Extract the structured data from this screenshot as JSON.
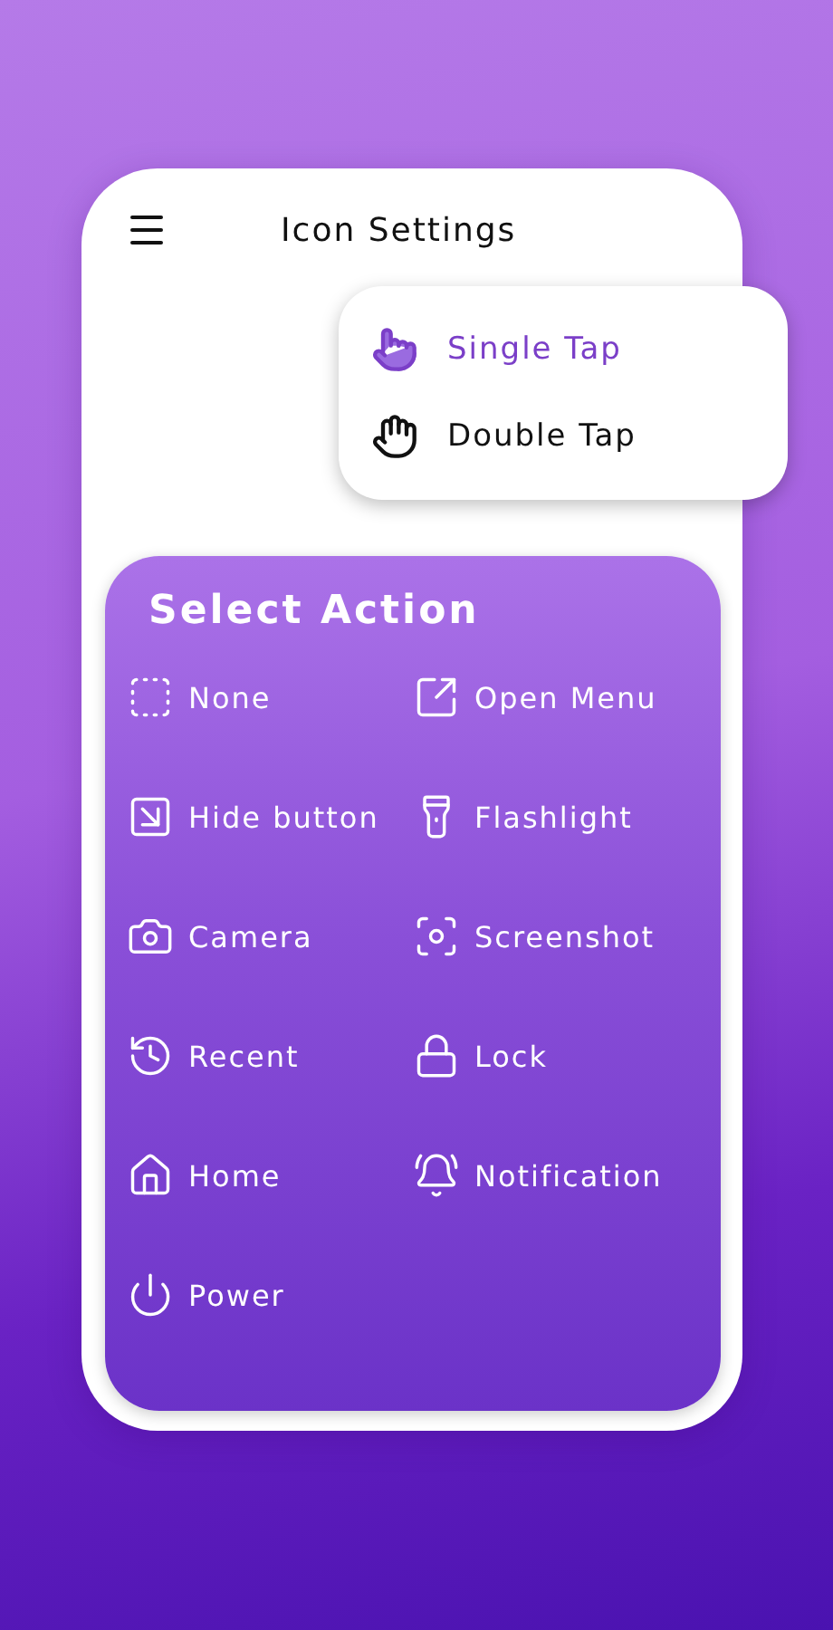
{
  "header": {
    "title": "Icon Settings"
  },
  "tap_menu": [
    {
      "label": "Single Tap",
      "kind": "single",
      "selected": true
    },
    {
      "label": "Double Tap",
      "kind": "double",
      "selected": false
    }
  ],
  "actions": {
    "title": "Select Action",
    "items": [
      {
        "label": "None",
        "kind": "none"
      },
      {
        "label": "Open Menu",
        "kind": "open"
      },
      {
        "label": "Hide button",
        "kind": "hide"
      },
      {
        "label": "Flashlight",
        "kind": "flash"
      },
      {
        "label": "Camera",
        "kind": "camera"
      },
      {
        "label": "Screenshot",
        "kind": "screenshot"
      },
      {
        "label": "Recent",
        "kind": "recent"
      },
      {
        "label": "Lock",
        "kind": "lock"
      },
      {
        "label": "Home",
        "kind": "home"
      },
      {
        "label": "Notification",
        "kind": "bell"
      },
      {
        "label": "Power",
        "kind": "power"
      }
    ]
  }
}
